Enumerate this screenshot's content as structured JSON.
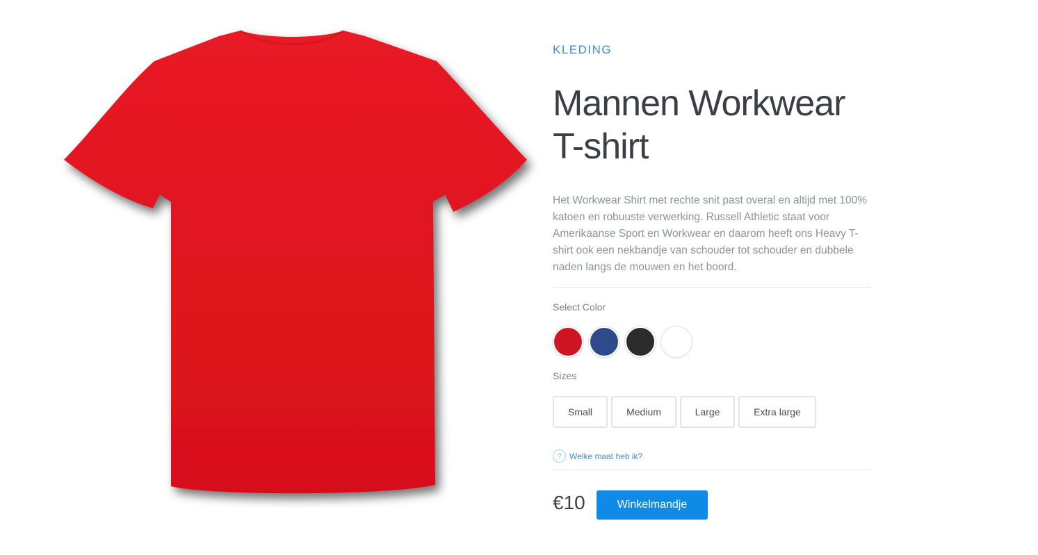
{
  "product": {
    "category": "KLEDING",
    "title": "Mannen Workwear T-shirt",
    "description": "Het Workwear Shirt met rechte snit past overal en altijd met 100% katoen en robuuste verwerking. Russell Athletic staat voor Amerikaanse Sport en Workwear en daarom heeft ons Heavy T-shirt ook een nekbandje van schouder tot schouder en dubbele naden langs de mouwen en het boord.",
    "image_icon": "tshirt-image",
    "image_color": "#e0141f"
  },
  "colors": {
    "label": "Select Color",
    "options": [
      {
        "hex": "#cf1525"
      },
      {
        "hex": "#2e4a8a"
      },
      {
        "hex": "#2b2b2b"
      },
      {
        "hex": "#ffffff"
      }
    ]
  },
  "sizes": {
    "label": "Sizes",
    "options": [
      "Small",
      "Medium",
      "Large",
      "Extra large"
    ]
  },
  "help": {
    "icon": "question-circle-icon",
    "text": "Welke maat heb ik?"
  },
  "purchase": {
    "price": "€10",
    "cart_label": "Winkelmandje"
  },
  "theme": {
    "accent": "#3f8ad8",
    "button": "#0f8ae6",
    "text": "#3b3f45",
    "muted": "#8c939c"
  }
}
